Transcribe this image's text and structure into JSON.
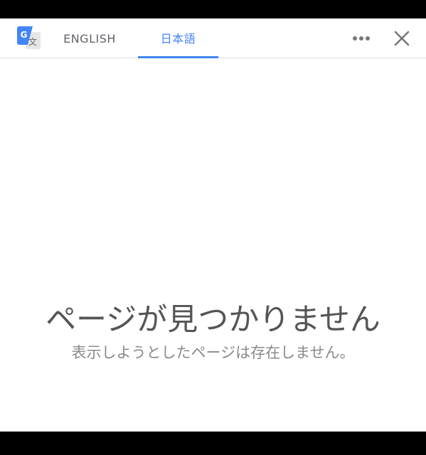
{
  "toolbar": {
    "logo_icon": "google-translate-icon",
    "tabs": [
      {
        "label": "ENGLISH",
        "active": false
      },
      {
        "label": "日本語",
        "active": true
      }
    ],
    "more_icon": "more-horizontal-icon",
    "close_icon": "close-icon",
    "accent_color": "#4285f4"
  },
  "error": {
    "title": "ページが見つかりません",
    "message": "表示しようとしたページは存在しません。"
  }
}
